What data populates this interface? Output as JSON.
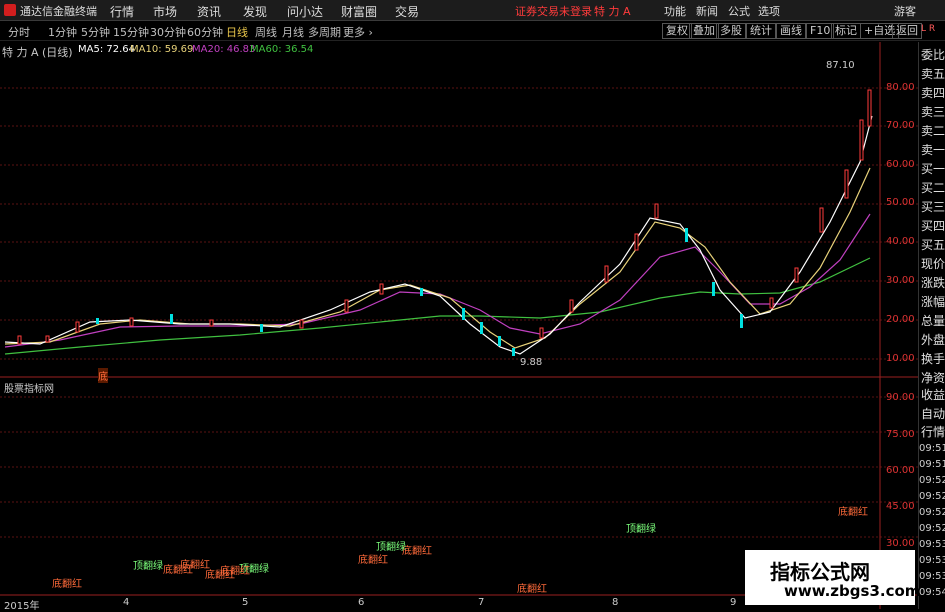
{
  "menubar": {
    "app_name": "通达信金融终端",
    "items": [
      "行情",
      "市场",
      "资讯",
      "发现",
      "问小达",
      "财富圈",
      "交易"
    ],
    "notice": "证券交易未登录",
    "stock_title": "特 力 A",
    "right_items": [
      "功能",
      "新闻",
      "公式",
      "选项"
    ],
    "guest": "游客"
  },
  "periods": {
    "items": [
      "分时",
      "1分钟",
      "5分钟",
      "15分钟",
      "30分钟",
      "60分钟",
      "日线",
      "周线",
      "月线",
      "多周期",
      "更多 ›"
    ],
    "active": "日线"
  },
  "toolbar_right": [
    "复权",
    "叠加",
    "多股",
    "统计",
    "画线",
    "F10",
    "标记",
    "+自选",
    "返回"
  ],
  "chart_header": {
    "stock": "特 力 A (日线)",
    "ma5": "MA5: 72.64",
    "ma10": "MA10: 59.69",
    "ma20": "MA20: 46.83",
    "ma60": "MA60: 36.54"
  },
  "price_axis": [
    "80.00",
    "70.00",
    "60.00",
    "50.00",
    "40.00",
    "30.00",
    "20.00",
    "10.00"
  ],
  "price_annotations": {
    "high": "87.10",
    "low": "9.88",
    "signal": "底"
  },
  "indicator_panel": {
    "title": "股票指标网",
    "axis": [
      "90.00",
      "75.00",
      "60.00",
      "45.00",
      "30.00"
    ],
    "signals": [
      "底翻红",
      "顶翻绿",
      "底翻红",
      "底翻红",
      "顶翻绿",
      "底翻红",
      "底翻红",
      "顶翻绿",
      "底翻红",
      "底翻红",
      "底翻红",
      "顶翻绿",
      "底翻红"
    ]
  },
  "x_axis": [
    "2015年",
    "4",
    "5",
    "6",
    "7",
    "8",
    "9"
  ],
  "side_panel": {
    "items": [
      "委比",
      "卖五",
      "卖四",
      "卖三",
      "卖二",
      "卖一",
      "买一",
      "买二",
      "买三",
      "买四",
      "买五",
      "现价",
      "涨跌",
      "涨幅",
      "总量",
      "外盘",
      "换手",
      "净资",
      "收益",
      "自动",
      "行情"
    ],
    "times": [
      "09:51",
      "09:51",
      "09:52",
      "09:52",
      "09:52",
      "09:52",
      "09:53",
      "09:53",
      "09:53",
      "09:54"
    ],
    "corner": "L R"
  },
  "watermark": {
    "line1": "指标公式网",
    "line2": "www.zbgs3.com"
  },
  "colors": {
    "up": "#ff3c3c",
    "down": "#00e0e0",
    "ma5": "#ffffff",
    "ma10": "#e8d27a",
    "ma20": "#c040c0",
    "ma60": "#40c040",
    "accent": "#e8c54a"
  },
  "chart_data": {
    "type": "line",
    "title": "特 力 A (日线)",
    "x": [
      "2015年",
      "4",
      "5",
      "6",
      "7",
      "8",
      "9"
    ],
    "ylim": [
      5,
      92
    ],
    "series": [
      {
        "name": "MA5",
        "values": [
          14,
          18,
          19,
          26,
          11,
          48,
          20,
          72.64
        ]
      },
      {
        "name": "MA10",
        "values": [
          13,
          17,
          18,
          25,
          13,
          45,
          22,
          59.69
        ]
      },
      {
        "name": "MA20",
        "values": [
          12,
          16,
          17,
          23,
          16,
          40,
          25,
          46.83
        ]
      },
      {
        "name": "MA60",
        "values": [
          11,
          13,
          15,
          20,
          21,
          30,
          27,
          36.54
        ]
      }
    ]
  }
}
